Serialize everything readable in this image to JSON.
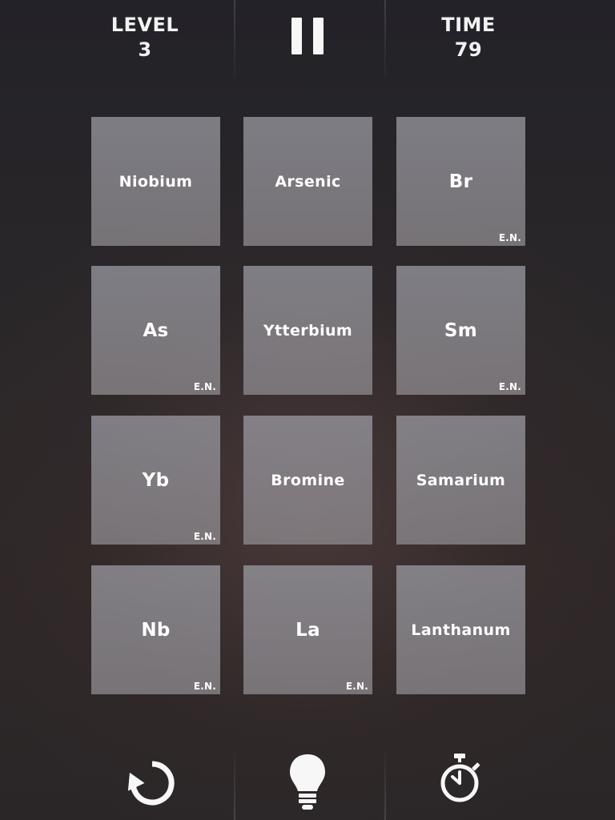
{
  "header": {
    "level_label": "LEVEL",
    "level_value": "3",
    "time_label": "TIME",
    "time_value": "79",
    "pause_icon": "pause-icon"
  },
  "board": {
    "tiles": [
      {
        "text": "Niobium",
        "kind": "name",
        "tag": ""
      },
      {
        "text": "Arsenic",
        "kind": "name",
        "tag": ""
      },
      {
        "text": "Br",
        "kind": "symbol",
        "tag": "E.N."
      },
      {
        "text": "As",
        "kind": "symbol",
        "tag": "E.N."
      },
      {
        "text": "Ytterbium",
        "kind": "name",
        "tag": ""
      },
      {
        "text": "Sm",
        "kind": "symbol",
        "tag": "E.N."
      },
      {
        "text": "Yb",
        "kind": "symbol",
        "tag": "E.N."
      },
      {
        "text": "Bromine",
        "kind": "name",
        "tag": ""
      },
      {
        "text": "Samarium",
        "kind": "name",
        "tag": ""
      },
      {
        "text": "Nb",
        "kind": "symbol",
        "tag": "E.N."
      },
      {
        "text": "La",
        "kind": "symbol",
        "tag": "E.N."
      },
      {
        "text": "Lanthanum",
        "kind": "name",
        "tag": ""
      }
    ]
  },
  "footer": {
    "buttons": [
      {
        "icon": "restart-icon"
      },
      {
        "icon": "lightbulb-icon"
      },
      {
        "icon": "stopwatch-icon"
      }
    ]
  },
  "colors": {
    "background": "#2a2729",
    "tile": "#8f8e95",
    "text": "#ffffff"
  }
}
